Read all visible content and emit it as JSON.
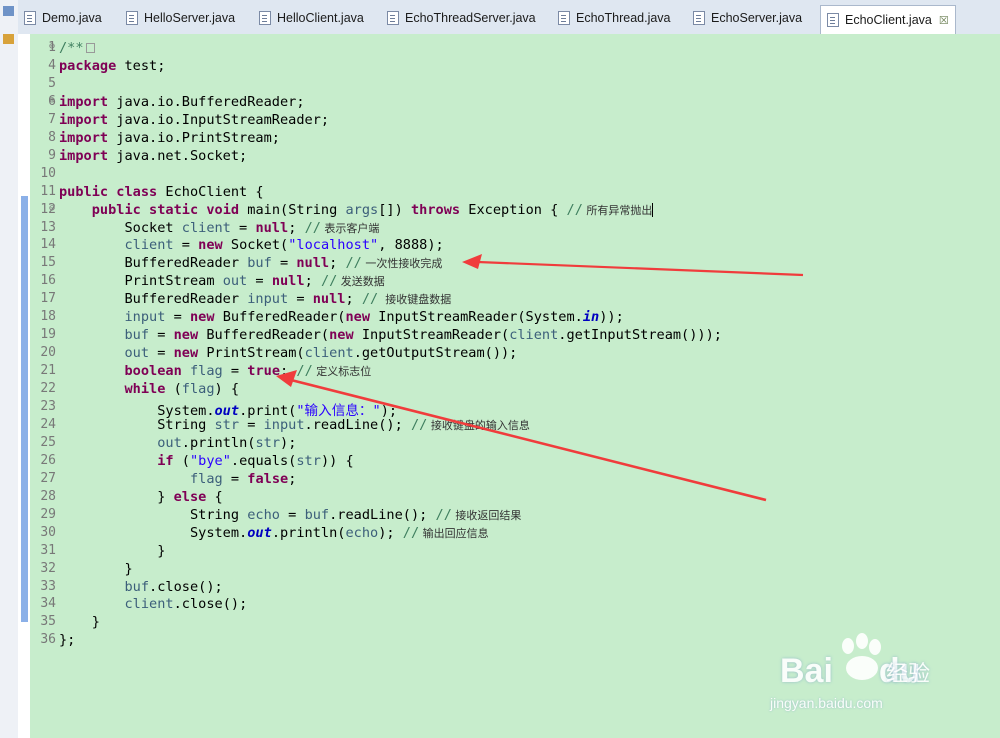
{
  "tabs": [
    {
      "label": "Demo.java",
      "active": false
    },
    {
      "label": "HelloServer.java",
      "active": false
    },
    {
      "label": "HelloClient.java",
      "active": false
    },
    {
      "label": "EchoThreadServer.java",
      "active": false
    },
    {
      "label": "EchoThread.java",
      "active": false
    },
    {
      "label": "EchoServer.java",
      "active": false
    },
    {
      "label": "EchoClient.java",
      "active": true,
      "close": "☒"
    }
  ],
  "editor": {
    "background": "#c7edcc",
    "lines": [
      {
        "n": "1",
        "fold": "⊕",
        "text": "/**"
      },
      {
        "n": "4",
        "text": "package test;"
      },
      {
        "n": "5",
        "text": ""
      },
      {
        "n": "6",
        "fold": "⊕",
        "text": "import java.io.BufferedReader;"
      },
      {
        "n": "7",
        "text": "import java.io.InputStreamReader;"
      },
      {
        "n": "8",
        "text": "import java.io.PrintStream;"
      },
      {
        "n": "9",
        "text": "import java.net.Socket;"
      },
      {
        "n": "10",
        "text": ""
      },
      {
        "n": "11",
        "text": "public class EchoClient {"
      },
      {
        "n": "12",
        "fold": "⊖",
        "text": "    public static void main(String args[]) throws Exception { // 所有异常抛出"
      },
      {
        "n": "13",
        "text": "        Socket client = null; // 表示客户端"
      },
      {
        "n": "14",
        "text": "        client = new Socket(\"localhost\", 8888);"
      },
      {
        "n": "15",
        "text": "        BufferedReader buf = null; // 一次性接收完成"
      },
      {
        "n": "16",
        "text": "        PrintStream out = null; // 发送数据"
      },
      {
        "n": "17",
        "text": "        BufferedReader input = null; //  接收键盘数据"
      },
      {
        "n": "18",
        "text": "        input = new BufferedReader(new InputStreamReader(System.in));"
      },
      {
        "n": "19",
        "text": "        buf = new BufferedReader(new InputStreamReader(client.getInputStream()));"
      },
      {
        "n": "20",
        "text": "        out = new PrintStream(client.getOutputStream());"
      },
      {
        "n": "21",
        "text": "        boolean flag = true; // 定义标志位"
      },
      {
        "n": "22",
        "text": "        while (flag) {"
      },
      {
        "n": "23",
        "text": "            System.out.print(\"输入信息：\");"
      },
      {
        "n": "24",
        "text": "            String str = input.readLine(); // 接收键盘的输入信息"
      },
      {
        "n": "25",
        "text": "            out.println(str);"
      },
      {
        "n": "26",
        "text": "            if (\"bye\".equals(str)) {"
      },
      {
        "n": "27",
        "text": "                flag = false;"
      },
      {
        "n": "28",
        "text": "            } else {"
      },
      {
        "n": "29",
        "text": "                String echo = buf.readLine(); // 接收返回结果"
      },
      {
        "n": "30",
        "text": "                System.out.println(echo); // 输出回应信息"
      },
      {
        "n": "31",
        "text": "            }"
      },
      {
        "n": "32",
        "text": "        }"
      },
      {
        "n": "33",
        "text": "        buf.close();"
      },
      {
        "n": "34",
        "text": "        client.close();"
      },
      {
        "n": "35",
        "text": "    }"
      },
      {
        "n": "36",
        "text": "};"
      }
    ]
  },
  "annotations": {
    "arrow_color": "#f03c3c",
    "targets": [
      "line-15-comment",
      "line-22-while"
    ]
  },
  "watermark": {
    "brand": "Bai",
    "brand_tail": "du",
    "cn": "经验",
    "url": "jingyan.baidu.com"
  }
}
